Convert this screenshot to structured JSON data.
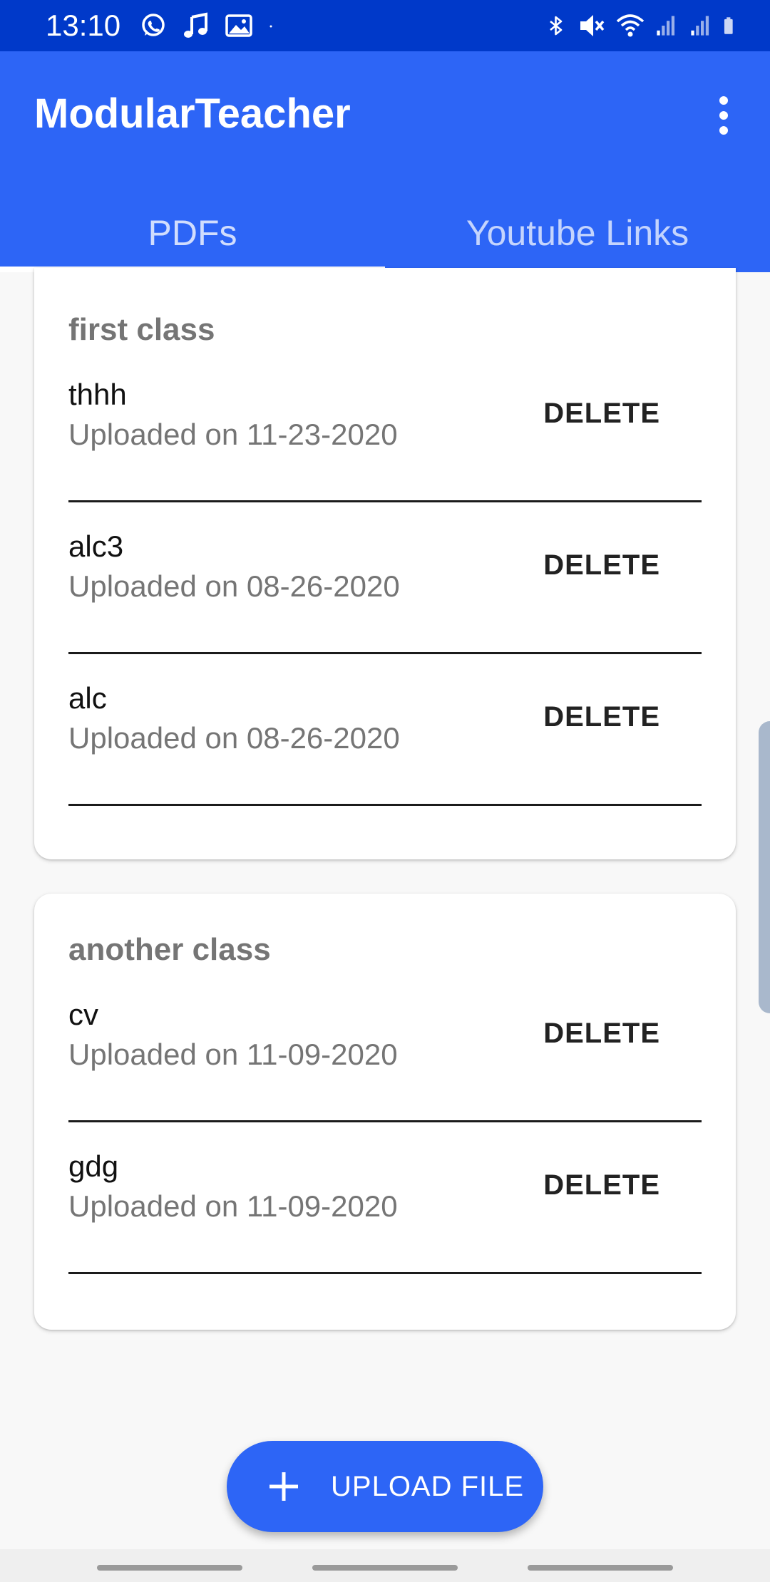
{
  "status_bar": {
    "time": "13:10",
    "left_icons": [
      "whatsapp-icon",
      "music-note-icon",
      "gallery-icon",
      "dot-icon"
    ],
    "right_icons": [
      "bluetooth-icon",
      "mute-icon",
      "wifi-icon",
      "signal-icon",
      "signal-icon",
      "battery-icon"
    ]
  },
  "app_bar": {
    "title": "ModularTeacher",
    "overflow_icon": "more-vert-icon",
    "background": "#2d65f6"
  },
  "tabs": [
    {
      "label": "PDFs",
      "active": true
    },
    {
      "label": "Youtube Links",
      "active": false
    }
  ],
  "classes": [
    {
      "title": "first class",
      "files": [
        {
          "name": "thhh",
          "date": "Uploaded on 11-23-2020",
          "action": "DELETE"
        },
        {
          "name": "alc3",
          "date": "Uploaded on 08-26-2020",
          "action": "DELETE"
        },
        {
          "name": "alc",
          "date": "Uploaded on 08-26-2020",
          "action": "DELETE"
        }
      ]
    },
    {
      "title": "another class",
      "files": [
        {
          "name": "cv",
          "date": "Uploaded on 11-09-2020",
          "action": "DELETE"
        },
        {
          "name": "gdg",
          "date": "Uploaded on 11-09-2020",
          "action": "DELETE"
        }
      ]
    }
  ],
  "fab": {
    "icon": "plus-icon",
    "label": "UPLOAD FILE"
  }
}
